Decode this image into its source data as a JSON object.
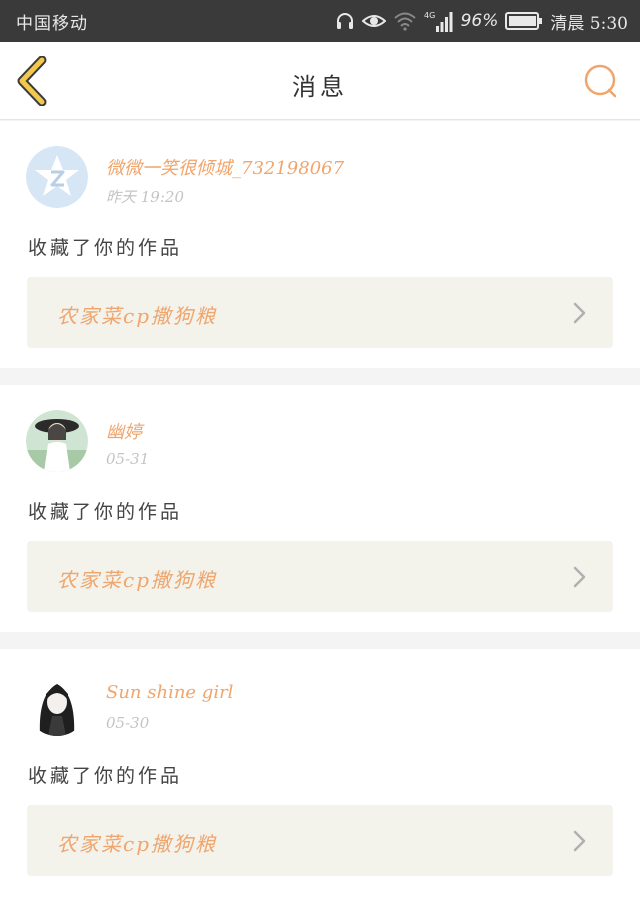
{
  "status_bar": {
    "carrier": "中国移动",
    "network": "4G",
    "battery": "96%",
    "time": "清晨 5:30"
  },
  "header": {
    "title": "消息"
  },
  "messages": [
    {
      "username": "微微一笑很倾城_732198067",
      "time": "昨天 19:20",
      "action": "收藏了你的作品",
      "work_title": "农家菜cp撒狗粮"
    },
    {
      "username": "幽婷",
      "time": "05-31",
      "action": "收藏了你的作品",
      "work_title": "农家菜cp撒狗粮"
    },
    {
      "username": "Sun shine girl",
      "time": "05-30",
      "action": "收藏了你的作品",
      "work_title": "农家菜cp撒狗粮"
    }
  ],
  "colors": {
    "accent": "#f0a56d",
    "back_arrow": "#f2c94c",
    "status_bar_bg": "#3a3a3a",
    "work_box_bg": "#f3f3ec"
  },
  "icons": [
    "back-arrow-icon",
    "search-icon",
    "headphone-icon",
    "eye-icon",
    "wifi-icon",
    "signal-icon",
    "battery-icon",
    "chevron-right-icon"
  ]
}
